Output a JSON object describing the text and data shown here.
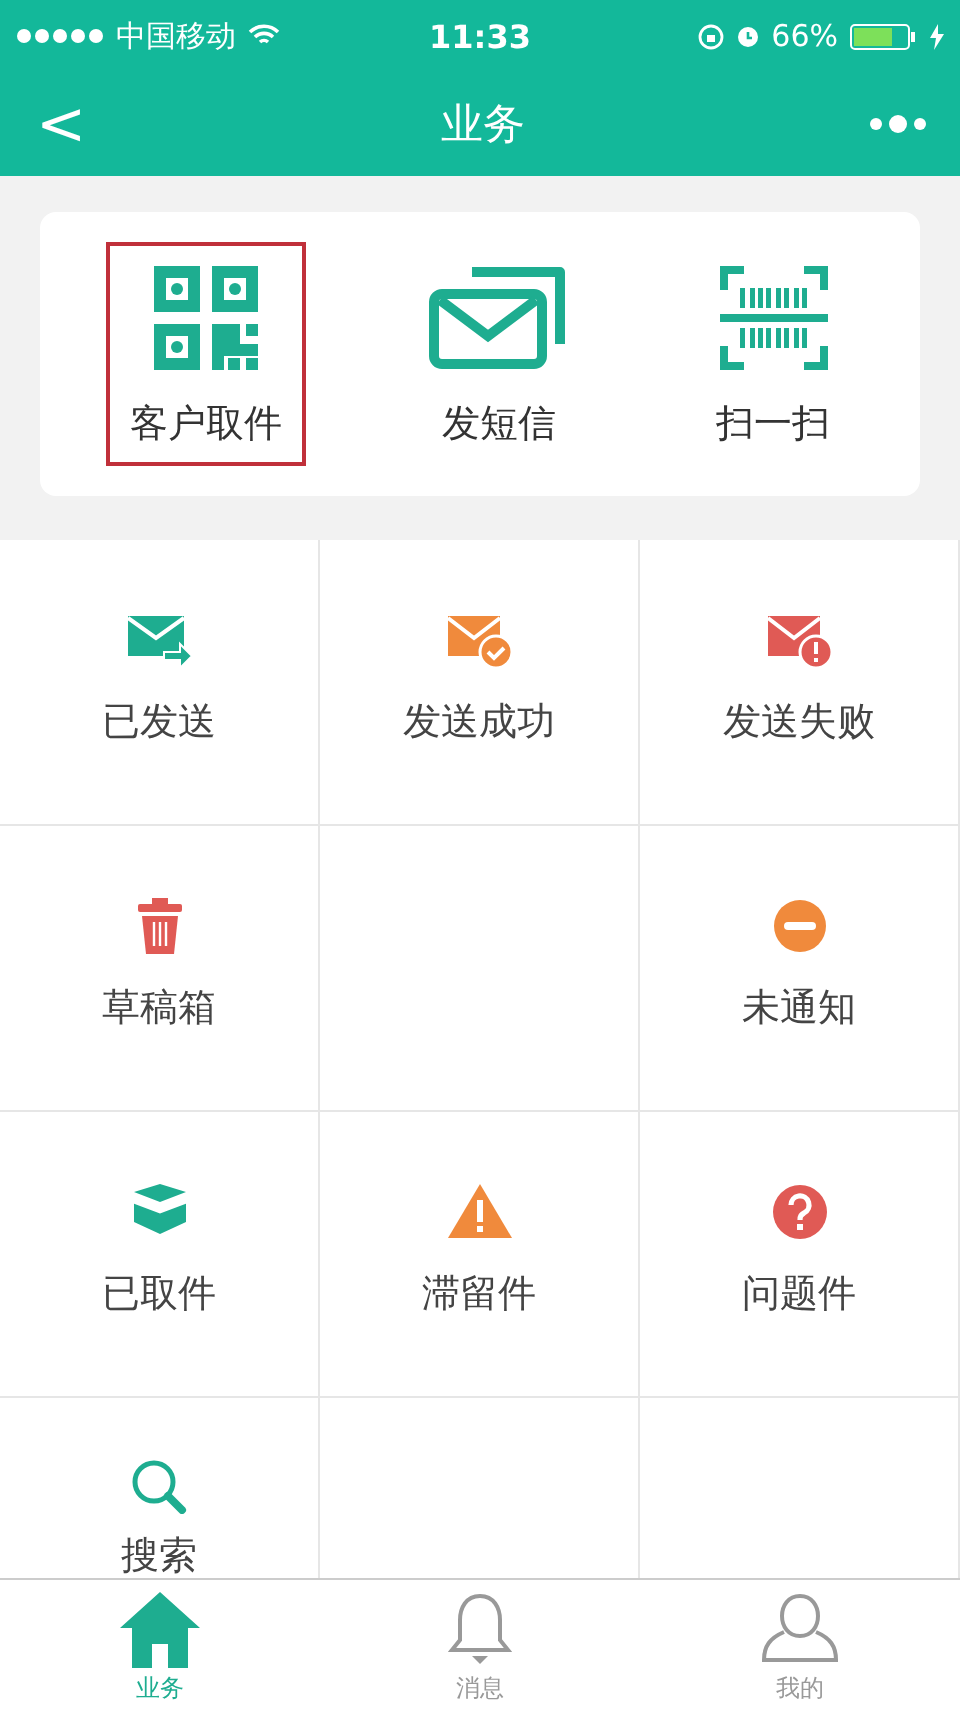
{
  "status_bar": {
    "carrier": "中国移动",
    "time": "11:33",
    "battery": "66%"
  },
  "nav_bar": {
    "back": "<",
    "title": "业务"
  },
  "quick_actions": [
    {
      "kind": "qr",
      "label": "客户取件",
      "selected": true
    },
    {
      "kind": "message",
      "label": "发短信",
      "selected": false
    },
    {
      "kind": "scan",
      "label": "扫一扫",
      "selected": false
    }
  ],
  "grid": [
    {
      "kind": "sent",
      "label": "已发送"
    },
    {
      "kind": "success",
      "label": "发送成功"
    },
    {
      "kind": "failed",
      "label": "发送失败"
    },
    {
      "kind": "trash",
      "label": "草稿箱"
    },
    {
      "kind": "empty"
    },
    {
      "kind": "minus",
      "label": "未通知"
    },
    {
      "kind": "box",
      "label": "已取件"
    },
    {
      "kind": "warning",
      "label": "滞留件"
    },
    {
      "kind": "question",
      "label": "问题件"
    },
    {
      "kind": "search",
      "label": "搜索"
    },
    {
      "kind": "empty"
    },
    {
      "kind": "empty"
    }
  ],
  "tab_bar": [
    {
      "kind": "home",
      "label": "业务",
      "selected": true
    },
    {
      "kind": "bell",
      "label": "消息",
      "selected": false
    },
    {
      "kind": "person",
      "label": "我的",
      "selected": false
    }
  ]
}
